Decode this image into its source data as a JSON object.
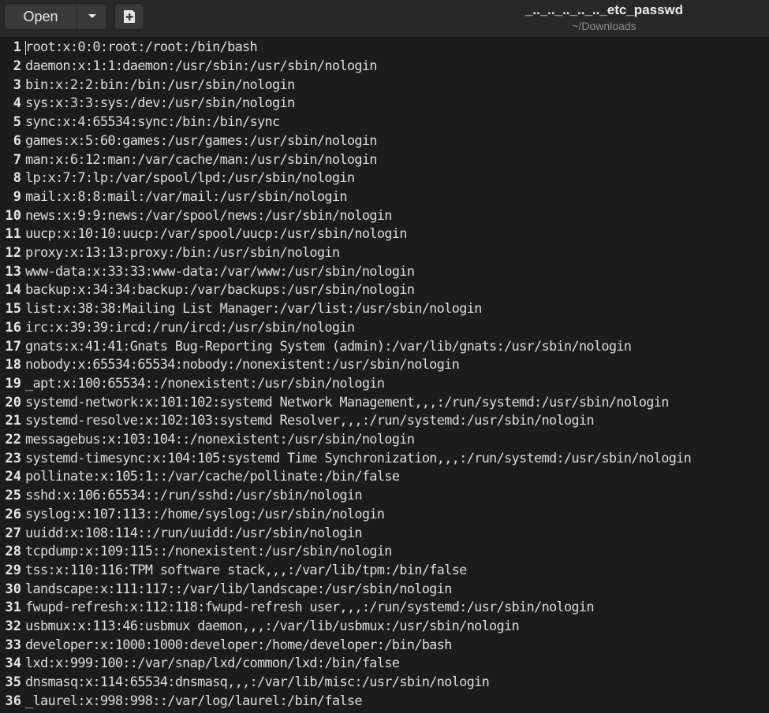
{
  "toolbar": {
    "open_label": "Open",
    "dropdown_icon": "chevron-down-icon",
    "new_tab_icon": "new-document-icon"
  },
  "header": {
    "title": "_.._.._.._.._.._etc_passwd",
    "subtitle": "~/Downloads"
  },
  "editor": {
    "lines": [
      {
        "num": "1",
        "text": "root:x:0:0:root:/root:/bin/bash"
      },
      {
        "num": "2",
        "text": "daemon:x:1:1:daemon:/usr/sbin:/usr/sbin/nologin"
      },
      {
        "num": "3",
        "text": "bin:x:2:2:bin:/bin:/usr/sbin/nologin"
      },
      {
        "num": "4",
        "text": "sys:x:3:3:sys:/dev:/usr/sbin/nologin"
      },
      {
        "num": "5",
        "text": "sync:x:4:65534:sync:/bin:/bin/sync"
      },
      {
        "num": "6",
        "text": "games:x:5:60:games:/usr/games:/usr/sbin/nologin"
      },
      {
        "num": "7",
        "text": "man:x:6:12:man:/var/cache/man:/usr/sbin/nologin"
      },
      {
        "num": "8",
        "text": "lp:x:7:7:lp:/var/spool/lpd:/usr/sbin/nologin"
      },
      {
        "num": "9",
        "text": "mail:x:8:8:mail:/var/mail:/usr/sbin/nologin"
      },
      {
        "num": "10",
        "text": "news:x:9:9:news:/var/spool/news:/usr/sbin/nologin"
      },
      {
        "num": "11",
        "text": "uucp:x:10:10:uucp:/var/spool/uucp:/usr/sbin/nologin"
      },
      {
        "num": "12",
        "text": "proxy:x:13:13:proxy:/bin:/usr/sbin/nologin"
      },
      {
        "num": "13",
        "text": "www-data:x:33:33:www-data:/var/www:/usr/sbin/nologin"
      },
      {
        "num": "14",
        "text": "backup:x:34:34:backup:/var/backups:/usr/sbin/nologin"
      },
      {
        "num": "15",
        "text": "list:x:38:38:Mailing List Manager:/var/list:/usr/sbin/nologin"
      },
      {
        "num": "16",
        "text": "irc:x:39:39:ircd:/run/ircd:/usr/sbin/nologin"
      },
      {
        "num": "17",
        "text": "gnats:x:41:41:Gnats Bug-Reporting System (admin):/var/lib/gnats:/usr/sbin/nologin"
      },
      {
        "num": "18",
        "text": "nobody:x:65534:65534:nobody:/nonexistent:/usr/sbin/nologin"
      },
      {
        "num": "19",
        "text": "_apt:x:100:65534::/nonexistent:/usr/sbin/nologin"
      },
      {
        "num": "20",
        "text": "systemd-network:x:101:102:systemd Network Management,,,:/run/systemd:/usr/sbin/nologin"
      },
      {
        "num": "21",
        "text": "systemd-resolve:x:102:103:systemd Resolver,,,:/run/systemd:/usr/sbin/nologin"
      },
      {
        "num": "22",
        "text": "messagebus:x:103:104::/nonexistent:/usr/sbin/nologin"
      },
      {
        "num": "23",
        "text": "systemd-timesync:x:104:105:systemd Time Synchronization,,,:/run/systemd:/usr/sbin/nologin"
      },
      {
        "num": "24",
        "text": "pollinate:x:105:1::/var/cache/pollinate:/bin/false"
      },
      {
        "num": "25",
        "text": "sshd:x:106:65534::/run/sshd:/usr/sbin/nologin"
      },
      {
        "num": "26",
        "text": "syslog:x:107:113::/home/syslog:/usr/sbin/nologin"
      },
      {
        "num": "27",
        "text": "uuidd:x:108:114::/run/uuidd:/usr/sbin/nologin"
      },
      {
        "num": "28",
        "text": "tcpdump:x:109:115::/nonexistent:/usr/sbin/nologin"
      },
      {
        "num": "29",
        "text": "tss:x:110:116:TPM software stack,,,:/var/lib/tpm:/bin/false"
      },
      {
        "num": "30",
        "text": "landscape:x:111:117::/var/lib/landscape:/usr/sbin/nologin"
      },
      {
        "num": "31",
        "text": "fwupd-refresh:x:112:118:fwupd-refresh user,,,:/run/systemd:/usr/sbin/nologin"
      },
      {
        "num": "32",
        "text": "usbmux:x:113:46:usbmux daemon,,,:/var/lib/usbmux:/usr/sbin/nologin"
      },
      {
        "num": "33",
        "text": "developer:x:1000:1000:developer:/home/developer:/bin/bash"
      },
      {
        "num": "34",
        "text": "lxd:x:999:100::/var/snap/lxd/common/lxd:/bin/false"
      },
      {
        "num": "35",
        "text": "dnsmasq:x:114:65534:dnsmasq,,,:/var/lib/misc:/usr/sbin/nologin"
      },
      {
        "num": "36",
        "text": "_laurel:x:998:998::/var/log/laurel:/bin/false"
      }
    ]
  }
}
